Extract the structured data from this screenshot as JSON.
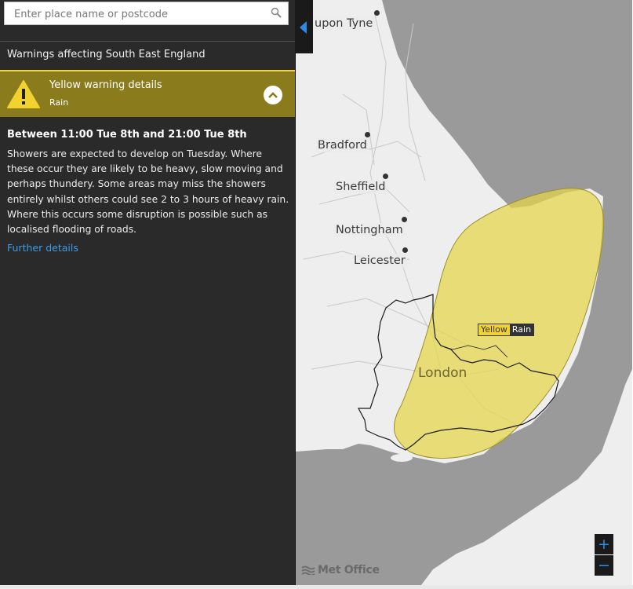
{
  "search": {
    "placeholder": "Enter place name or postcode"
  },
  "sidebar": {
    "region_title": "Warnings affecting South East England",
    "warning": {
      "title": "Yellow warning details",
      "type": "Rain",
      "level_color": "#f0d43a",
      "header_color": "#8a7b1d"
    },
    "time_range": "Between 11:00 Tue 8th and 21:00 Tue 8th",
    "description": "Showers are expected to develop on Tuesday. Where these occur they are likely to be heavy, slow moving and perhaps thundery. Some areas may miss the showers entirely whilst others could see 2 to 3 hours of heavy rain. Where this occurs some disruption is possible such as localised flooding of roads.",
    "further_details": "Further details"
  },
  "map": {
    "cities": {
      "newcastle": "upon Tyne",
      "bradford": "Bradford",
      "sheffield": "Sheffield",
      "nottingham": "Nottingham",
      "leicester": "Leicester",
      "london": "London"
    },
    "warning_label": {
      "level": "Yellow",
      "type": "Rain"
    },
    "zoom_in": "+",
    "zoom_out": "−",
    "logo_text": "Met Office",
    "colors": {
      "land": "#eeeeee",
      "sea": "#9a9a9a",
      "warning_area": "#e8d64a"
    }
  }
}
